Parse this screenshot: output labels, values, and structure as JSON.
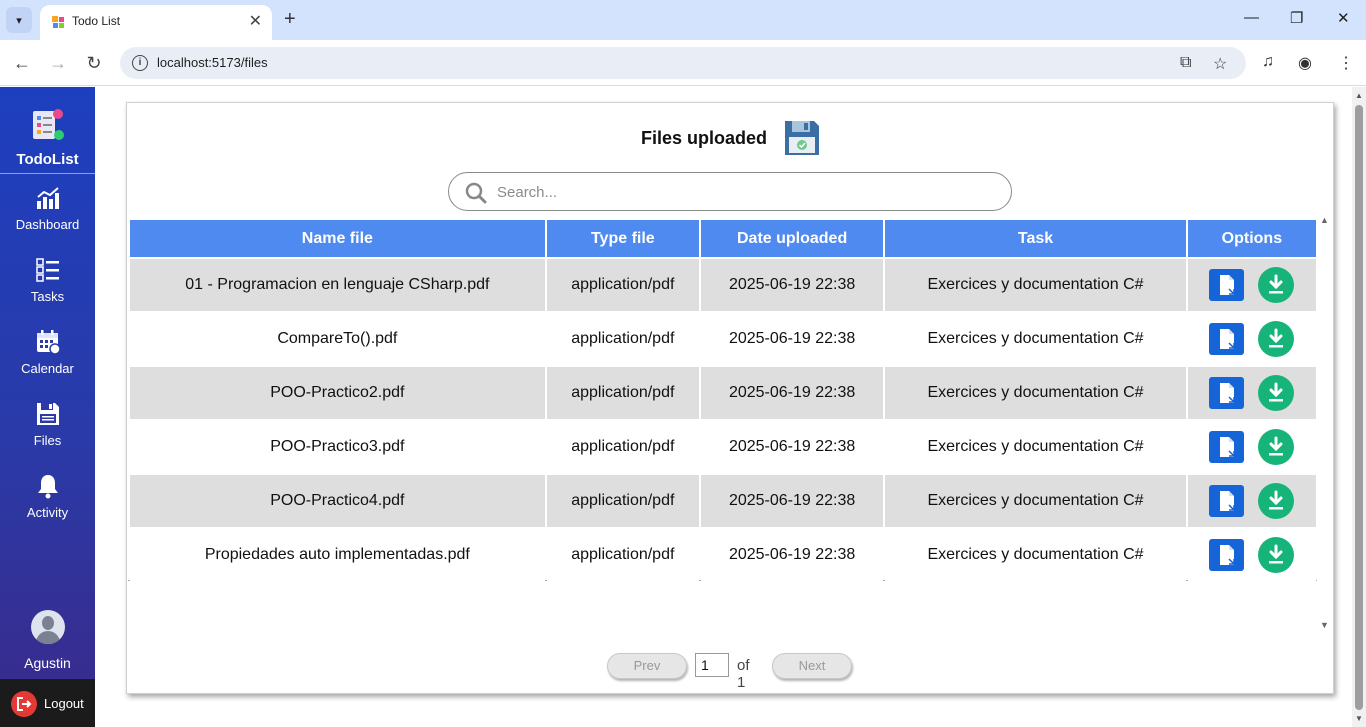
{
  "browser": {
    "tab_title": "Todo List",
    "url": "localhost:5173/files"
  },
  "sidebar": {
    "brand": "TodoList",
    "items": [
      {
        "label": "Dashboard",
        "icon": "chart-icon"
      },
      {
        "label": "Tasks",
        "icon": "checklist-icon"
      },
      {
        "label": "Calendar",
        "icon": "calendar-icon"
      },
      {
        "label": "Files",
        "icon": "floppy-icon"
      },
      {
        "label": "Activity",
        "icon": "bell-icon"
      }
    ],
    "user": "Agustin",
    "logout": "Logout"
  },
  "main": {
    "title": "Files uploaded",
    "search_placeholder": "Search...",
    "columns": [
      "Name file",
      "Type file",
      "Date uploaded",
      "Task",
      "Options"
    ],
    "rows": [
      {
        "name": "01 - Programacion en lenguaje CSharp.pdf",
        "type": "application/pdf",
        "date": "2025-06-19 22:38",
        "task": "Exercices y documentation C#"
      },
      {
        "name": "CompareTo().pdf",
        "type": "application/pdf",
        "date": "2025-06-19 22:38",
        "task": "Exercices y documentation C#"
      },
      {
        "name": "POO-Practico2.pdf",
        "type": "application/pdf",
        "date": "2025-06-19 22:38",
        "task": "Exercices y documentation C#"
      },
      {
        "name": "POO-Practico3.pdf",
        "type": "application/pdf",
        "date": "2025-06-19 22:38",
        "task": "Exercices y documentation C#"
      },
      {
        "name": "POO-Practico4.pdf",
        "type": "application/pdf",
        "date": "2025-06-19 22:38",
        "task": "Exercices y documentation C#"
      },
      {
        "name": "Propiedades auto implementadas.pdf",
        "type": "application/pdf",
        "date": "2025-06-19 22:38",
        "task": "Exercices y documentation C#"
      }
    ],
    "pager": {
      "prev": "Prev",
      "page": "1",
      "of": "of 1",
      "next": "Next"
    }
  },
  "colors": {
    "accent": "#4f8af0",
    "file_button": "#1565d8",
    "download_button": "#17b47a"
  }
}
